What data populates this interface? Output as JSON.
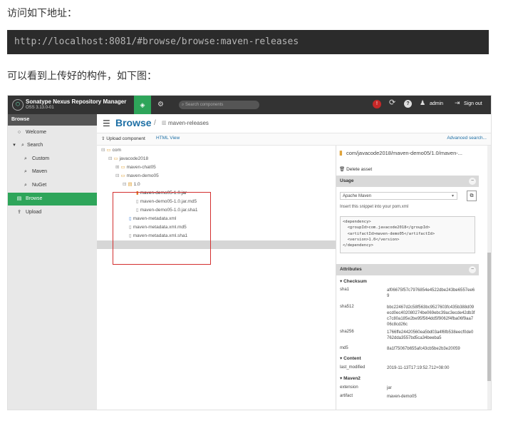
{
  "article": {
    "intro_text": "访问如下地址：",
    "url": "http://localhost:8081/#browse/browse:maven-releases",
    "after_text": "可以看到上传好的构件，如下图："
  },
  "app": {
    "name": "Sonatype Nexus Repository Manager",
    "version": "OSS 3.13.0-01",
    "search_placeholder": "Search components",
    "alert": "!",
    "user": "admin",
    "sign_out": "Sign out",
    "accent_color": "#2ea55a"
  },
  "sidebar": {
    "header": "Browse",
    "items": [
      {
        "label": "Welcome",
        "icon": "circle-icon"
      },
      {
        "label": "Search",
        "icon": "search-icon"
      },
      {
        "label": "Custom",
        "icon": "search-icon"
      },
      {
        "label": "Maven",
        "icon": "search-icon"
      },
      {
        "label": "NuGet",
        "icon": "search-icon"
      },
      {
        "label": "Browse",
        "icon": "database-icon",
        "active": true
      },
      {
        "label": "Upload",
        "icon": "upload-icon"
      }
    ]
  },
  "breadcrumb": {
    "section": "Browse",
    "repo": "maven-releases"
  },
  "toolbar": {
    "upload": "Upload component",
    "html_view": "HTML View",
    "advanced": "Advanced search..."
  },
  "tree": [
    {
      "label": "com",
      "type": "folder"
    },
    {
      "label": "javacode2018",
      "type": "folder"
    },
    {
      "label": "maven-chat05",
      "type": "folder"
    },
    {
      "label": "maven-demo05",
      "type": "folder"
    },
    {
      "label": "1.0",
      "type": "folder"
    },
    {
      "label": "maven-demo05-1.0.jar",
      "type": "jar",
      "selected": true
    },
    {
      "label": "maven-demo05-1.0.jar.md5",
      "type": "file"
    },
    {
      "label": "maven-demo05-1.0.jar.sha1",
      "type": "file"
    },
    {
      "label": "maven-metadata.xml",
      "type": "xml"
    },
    {
      "label": "maven-metadata.xml.md5",
      "type": "file"
    },
    {
      "label": "maven-metadata.xml.sha1",
      "type": "file"
    }
  ],
  "detail": {
    "path": "com/javacode2018/maven-demo05/1.0/maven-...",
    "delete": "Delete asset",
    "usage": {
      "title": "Usage",
      "format": "Apache Maven",
      "note": "Insert this snippet into your pom.xml",
      "snippet": "<dependency>\n  <groupId>com.javacode2018</groupId>\n  <artifactId>maven-demo05</artifactId>\n  <version>1.0</version>\n</dependency>"
    },
    "attributes": {
      "title": "Attributes",
      "groups": [
        {
          "name": "Checksum",
          "rows": [
            {
              "key": "sha1",
              "value": "af06675f57c7976854e4522dbe243be6557ee69"
            },
            {
              "key": "sha512",
              "value": "bbc22467d2c58f563bc9527603fc435b388d09ecd0ec402080274be069ebc39ac3ecde42db3fc7c80a185e2be95f564dd5f9062f4fba06f9aa706c8cd26c"
            },
            {
              "key": "sha256",
              "value": "1766ffe24420560ea5bd03a4f6fb538eecf0de0762dda3557bd5ca34beeba5"
            },
            {
              "key": "md5",
              "value": "8a1f75067b655afc43cb5be2b3e20059"
            }
          ]
        },
        {
          "name": "Content",
          "rows": [
            {
              "key": "last_modified",
              "value": "2019-11-13T17:19:52.712+08:00"
            }
          ]
        },
        {
          "name": "Maven2",
          "rows": [
            {
              "key": "extension",
              "value": "jar"
            },
            {
              "key": "artifact",
              "value": "maven-demo05"
            }
          ]
        }
      ]
    }
  }
}
